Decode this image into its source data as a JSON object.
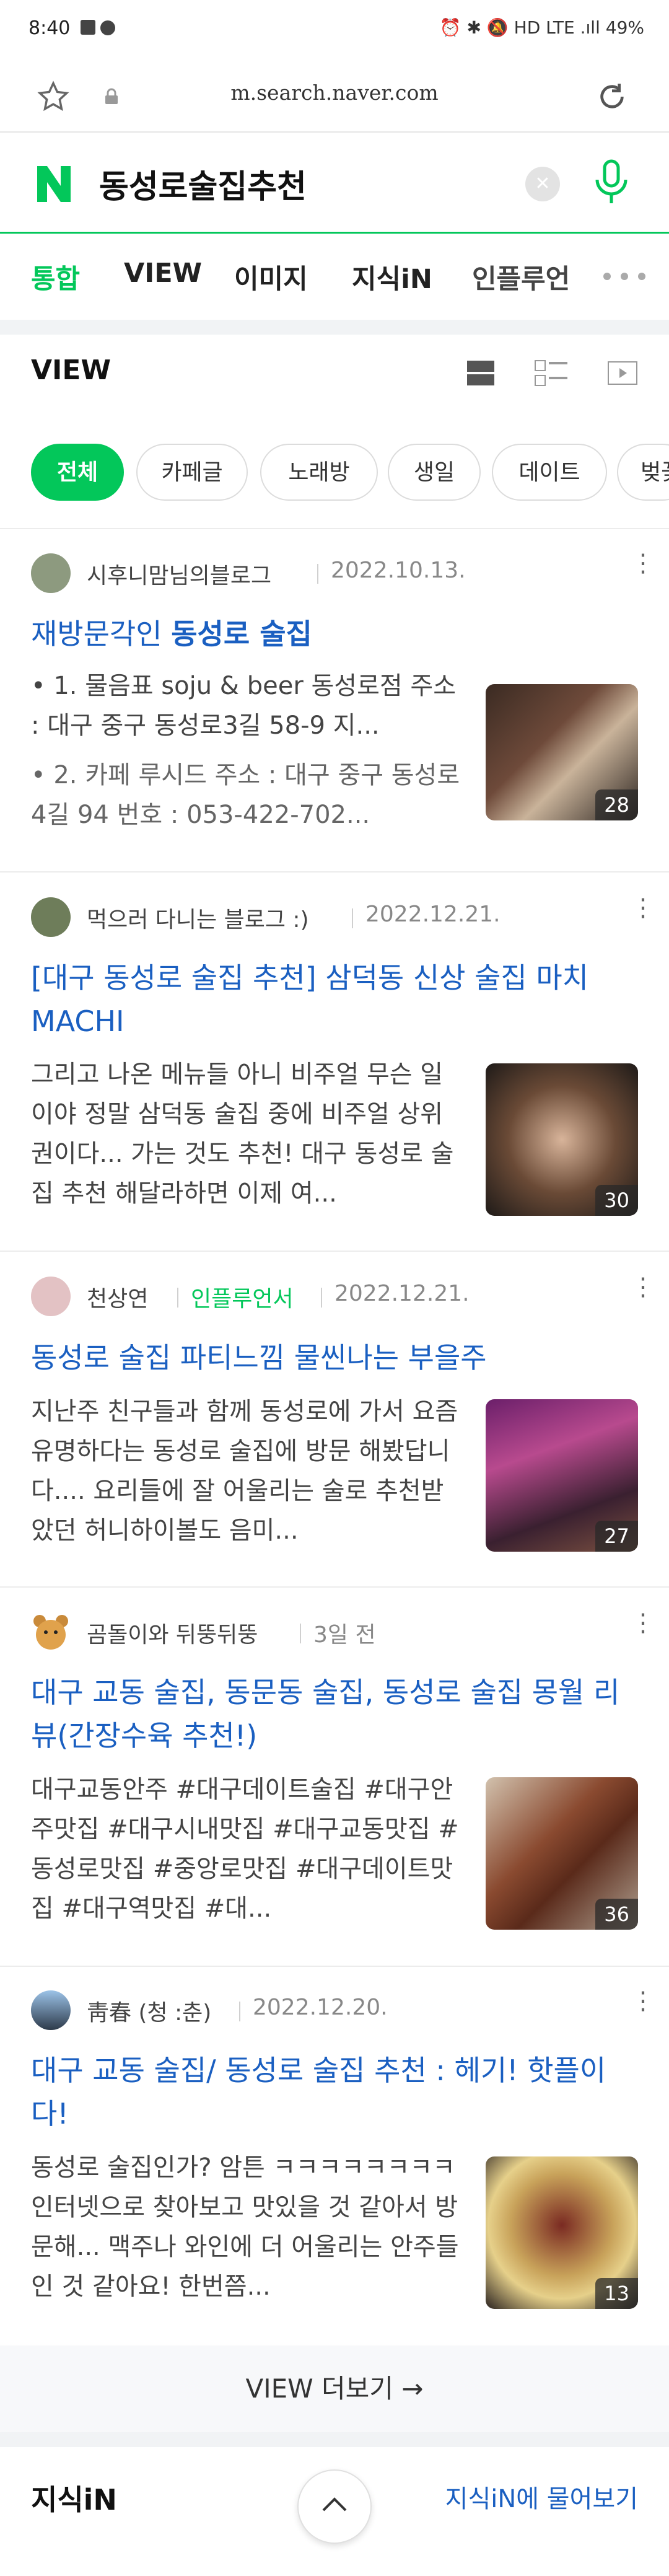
{
  "status_bar": {
    "time": "8:40",
    "right_text": "⏰ ✱ 🔕 HD LTE .ıll 49%"
  },
  "browser": {
    "url": "m.search.naver.com"
  },
  "search": {
    "query": "동성로술집추천",
    "clear_label": "✕"
  },
  "tabs": [
    "통합",
    "VIEW",
    "이미지",
    "지식iN",
    "인플루언"
  ],
  "view_section": {
    "title": "VIEW"
  },
  "chips": [
    "전체",
    "카페글",
    "노래방",
    "생일",
    "데이트",
    "벚꽃"
  ],
  "posts": [
    {
      "author": "시후니맘님의블로그",
      "date": "2022.10.13.",
      "title_parts": [
        "재방문각인 ",
        "동성로 술집"
      ],
      "bullets": [
        "1. 물음표 soju & beer 동성로점 주소 : 대구 중구 동성로3길 58-9 지...",
        "2. 카페 루시드 주소 : 대구 중구 동성로4길 94 번호 : 053-422-702..."
      ],
      "image_count": "28"
    },
    {
      "author": "먹으러 다니는 블로그 :)",
      "date": "2022.12.21.",
      "title": "[대구 동성로 술집 추천] 삼덕동 신상 술집 마치 MACHI",
      "snippet": "그리고 나온 메뉴들 아니 비주얼 무슨 일이야 정말 삼덕동 술집 중에 비주얼 상위권이다... 가는 것도 추천! 대구 동성로 술집 추천 해달라하면 이제 여...",
      "image_count": "30"
    },
    {
      "author": "천상연",
      "badge": "인플루언서",
      "date": "2022.12.21.",
      "title": "동성로 술집 파티느낌 물씬나는 부을주",
      "snippet": "지난주 친구들과 함께 동성로에 가서 요즘 유명하다는 동성로 술집에 방문 해봤답니다.... 요리들에 잘 어울리는 술로 추천받았던 허니하이볼도 음미...",
      "image_count": "27"
    },
    {
      "author": "곰돌이와 뒤뚱뒤뚱",
      "date": "3일 전",
      "title": "대구 교동 술집, 동문동 술집, 동성로 술집 몽월 리뷰(간장수육 추천!)",
      "snippet": "대구교동안주 #대구데이트술집 #대구안주맛집 #대구시내맛집 #대구교동맛집 #동성로맛집 #중앙로맛집 #대구데이트맛집 #대구역맛집 #대...",
      "image_count": "36"
    },
    {
      "author": "靑春 (청 :춘)",
      "date": "2022.12.20.",
      "title": "대구 교동 술집/ 동성로 술집 추천 : 헤기! 핫플이다!",
      "snippet": "동성로 술집인가? 암튼 ㅋㅋㅋㅋㅋㅋㅋㅋ 인터넷으로 찾아보고 맛있을 것 같아서 방문해... 맥주나 와인에 더 어울리는 안주들인 것 같아요! 한번쯤...",
      "image_count": "13"
    }
  ],
  "view_more": "VIEW 더보기 →",
  "kin": {
    "title": "지식iN",
    "ask": "지식iN에 물어보기"
  },
  "colors": {
    "accent": "#03c75a",
    "link": "#1a5fc1"
  }
}
